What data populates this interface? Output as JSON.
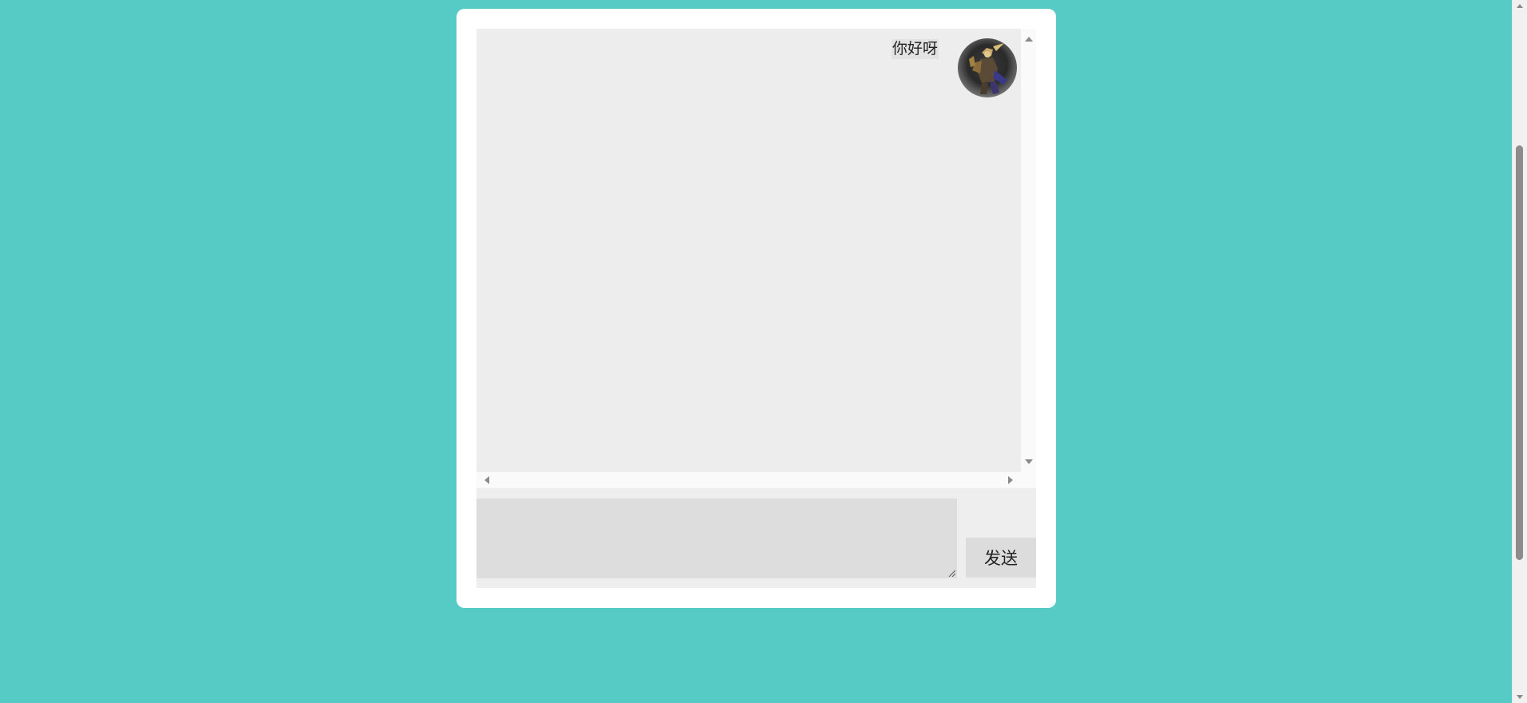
{
  "chat": {
    "messages": [
      {
        "text": "你好呀",
        "side": "right",
        "avatar": "warrior-avatar"
      }
    ]
  },
  "composer": {
    "input_value": "",
    "send_label": "发送"
  },
  "colors": {
    "page_background": "#56cac4",
    "card_background": "#ffffff",
    "message_area_background": "#ededed",
    "input_background": "#dddddd",
    "send_button_background": "#dcdcdc"
  },
  "icons": [
    "scroll-up-icon",
    "scroll-down-icon",
    "scroll-left-icon",
    "scroll-right-icon",
    "resize-grip-icon"
  ]
}
